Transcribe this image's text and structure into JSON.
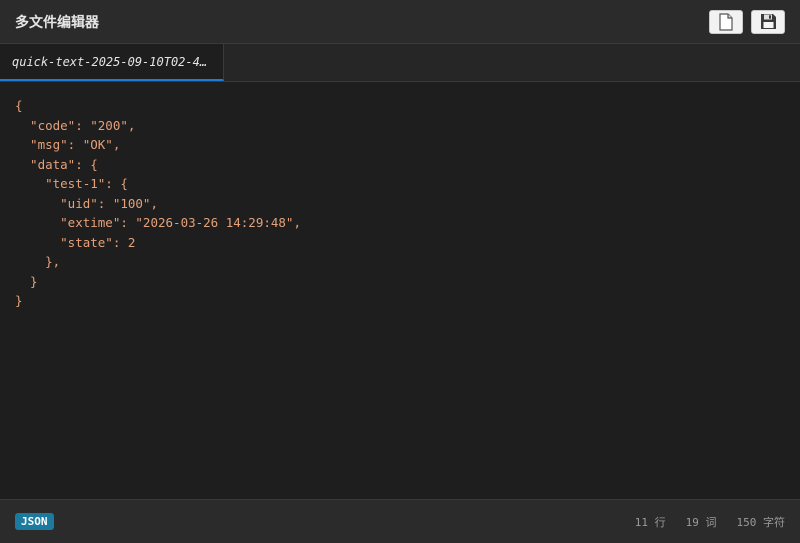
{
  "app": {
    "title": "多文件编辑器"
  },
  "toolbar": {
    "new_file_icon": "file-icon",
    "save_icon": "floppy-disk-icon"
  },
  "tabs": [
    {
      "label": "quick-text-2025-09-10T02-4…",
      "active": true
    }
  ],
  "editor": {
    "content": "{\n  \"code\": \"200\",\n  \"msg\": \"OK\",\n  \"data\": {\n    \"test-1\": {\n      \"uid\": \"100\",\n      \"extime\": \"2026-03-26 14:29:48\",\n      \"state\": 2\n    },\n  }\n}"
  },
  "status": {
    "language": "JSON",
    "lines": "11 行",
    "words": "19 词",
    "chars": "150 字符"
  },
  "colors": {
    "accent": "#1f7ad1",
    "badge": "#1a7aa0",
    "code_text": "#e5a07a",
    "background": "#1e1e1e"
  }
}
